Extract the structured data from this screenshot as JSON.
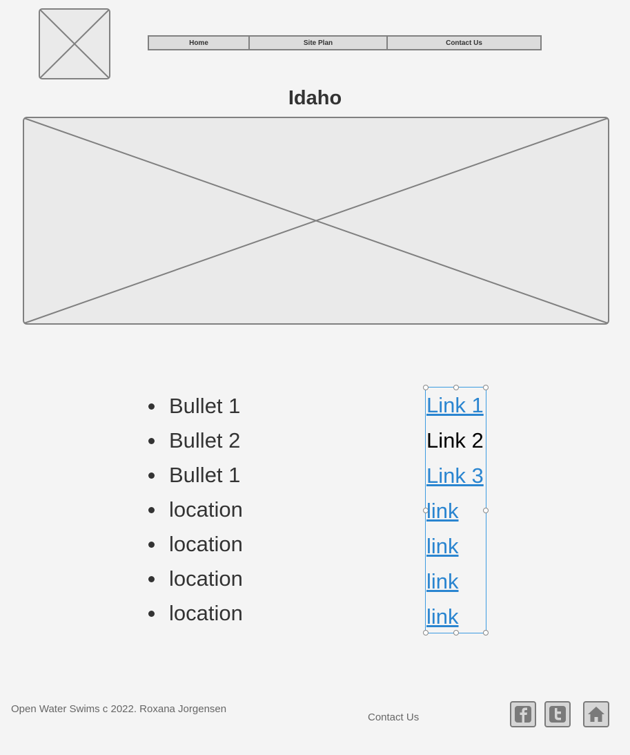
{
  "nav": {
    "items": [
      {
        "label": "Home"
      },
      {
        "label": "Site Plan"
      },
      {
        "label": "Contact Us"
      }
    ]
  },
  "page": {
    "title": "Idaho"
  },
  "bullets": [
    "Bullet 1",
    "Bullet 2",
    "Bullet 1",
    "location",
    "location",
    "location",
    "location"
  ],
  "links": [
    "Link 1",
    "Link 2",
    "Link 3",
    "link",
    "link",
    "link",
    "link"
  ],
  "footer": {
    "copyright": "Open Water Swims  c 2022.  Roxana Jorgensen",
    "contact": "Contact Us"
  },
  "social": {
    "icons": [
      "facebook-icon",
      "twitter-icon",
      "home-icon"
    ]
  },
  "colors": {
    "link": "#2a85d0",
    "selection": "#3b9be0",
    "placeholder_stroke": "#808080",
    "background": "#f4f4f4"
  }
}
